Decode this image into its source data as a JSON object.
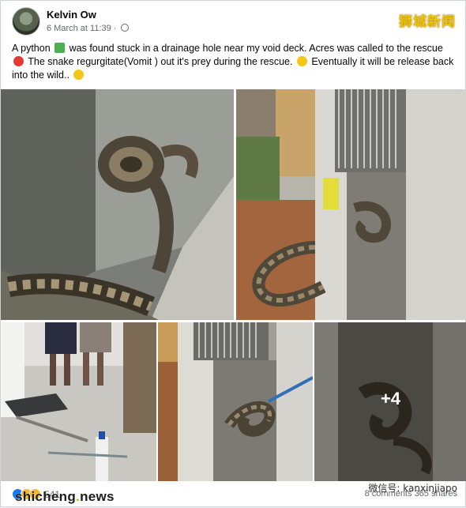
{
  "post": {
    "author": "Kelvin Ow",
    "date": "6 March at 11:39",
    "caption_parts": {
      "p1": "A python",
      "p2": "was found stuck in a drainage hole near my void deck. Acres was called to the rescue",
      "p3": "The snake regurgitate(Vomit ) out it's prey during the rescue.",
      "p4": "Eventually it will be release back into the wild.."
    },
    "icons": [
      "globe-icon",
      "python-emoji",
      "acres-emoji",
      "wow-emoji",
      "smile-emoji"
    ],
    "more_photos_label": "+4"
  },
  "footer": {
    "reaction_count": "541",
    "comments": "8 comments",
    "shares": "365 shares"
  },
  "watermarks": {
    "top_right": "狮城新闻",
    "bottom_left_a": "shicheng",
    "bottom_left_dot": ".",
    "bottom_left_b": "news",
    "bottom_right": "微信号: kanxinjiapo"
  },
  "colors": {
    "like_blue": "#1877f2",
    "watermark_gold": "#f2c300",
    "meta_grey": "#65676b"
  }
}
